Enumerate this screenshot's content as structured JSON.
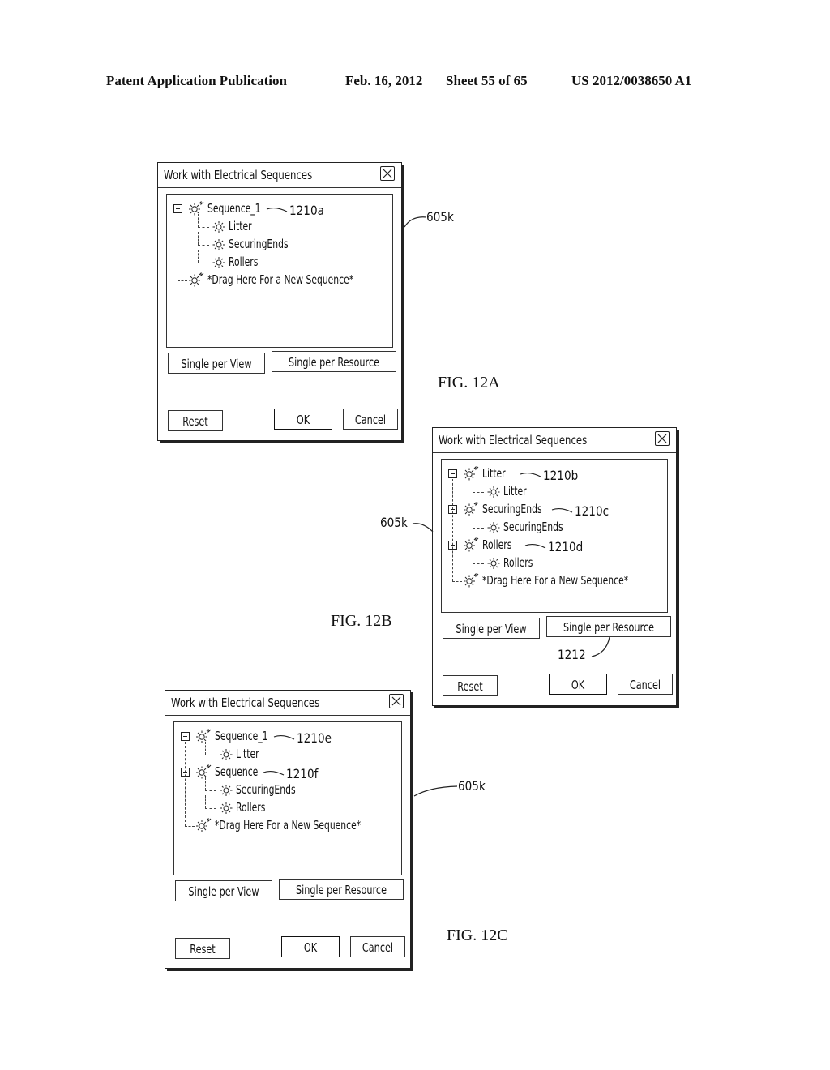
{
  "header": {
    "publication": "Patent Application Publication",
    "date": "Feb. 16, 2012",
    "sheet": "Sheet 55 of 65",
    "number": "US 2012/0038650 A1"
  },
  "figures": [
    {
      "label": "FIG. 12A",
      "dialog_ref": "605k",
      "title": "Work with Electrical Sequences",
      "tree": [
        {
          "text": "Sequence_1",
          "level": 0,
          "expander": true,
          "icon": "sequence-icon",
          "ref": "1210a"
        },
        {
          "text": "Litter",
          "level": 1,
          "icon": "resource-icon"
        },
        {
          "text": "SecuringEnds",
          "level": 1,
          "icon": "resource-icon"
        },
        {
          "text": "Rollers",
          "level": 1,
          "icon": "resource-icon"
        },
        {
          "text": "*Drag Here For a New Sequence*",
          "level": 0,
          "icon": "sequence-icon"
        }
      ],
      "buttons": {
        "single_view": "Single per View",
        "single_resource": "Single per Resource",
        "reset": "Reset",
        "ok": "OK",
        "cancel": "Cancel"
      }
    },
    {
      "label": "FIG. 12B",
      "dialog_ref": "605k",
      "button_ref": "1212",
      "title": "Work with Electrical Sequences",
      "tree": [
        {
          "text": "Litter",
          "level": 0,
          "expander": true,
          "icon": "sequence-icon",
          "ref": "1210b"
        },
        {
          "text": "Litter",
          "level": 1,
          "icon": "resource-icon"
        },
        {
          "text": "SecuringEnds",
          "level": 0,
          "expander": true,
          "icon": "sequence-icon",
          "ref": "1210c"
        },
        {
          "text": "SecuringEnds",
          "level": 1,
          "icon": "resource-icon"
        },
        {
          "text": "Rollers",
          "level": 0,
          "expander": true,
          "icon": "sequence-icon",
          "ref": "1210d"
        },
        {
          "text": "Rollers",
          "level": 1,
          "icon": "resource-icon"
        },
        {
          "text": "*Drag Here For a New Sequence*",
          "level": 0,
          "icon": "sequence-icon"
        }
      ],
      "buttons": {
        "single_view": "Single per View",
        "single_resource": "Single per Resource",
        "reset": "Reset",
        "ok": "OK",
        "cancel": "Cancel"
      }
    },
    {
      "label": "FIG. 12C",
      "dialog_ref": "605k",
      "title": "Work with Electrical Sequences",
      "tree": [
        {
          "text": "Sequence_1",
          "level": 0,
          "expander": true,
          "icon": "sequence-icon",
          "ref": "1210e"
        },
        {
          "text": "Litter",
          "level": 1,
          "icon": "resource-icon"
        },
        {
          "text": "Sequence",
          "level": 0,
          "expander": true,
          "icon": "sequence-icon",
          "ref": "1210f"
        },
        {
          "text": "SecuringEnds",
          "level": 1,
          "icon": "resource-icon"
        },
        {
          "text": "Rollers",
          "level": 1,
          "icon": "resource-icon"
        },
        {
          "text": "*Drag Here For a New Sequence*",
          "level": 0,
          "icon": "sequence-icon"
        }
      ],
      "buttons": {
        "single_view": "Single per View",
        "single_resource": "Single per Resource",
        "reset": "Reset",
        "ok": "OK",
        "cancel": "Cancel"
      }
    }
  ]
}
